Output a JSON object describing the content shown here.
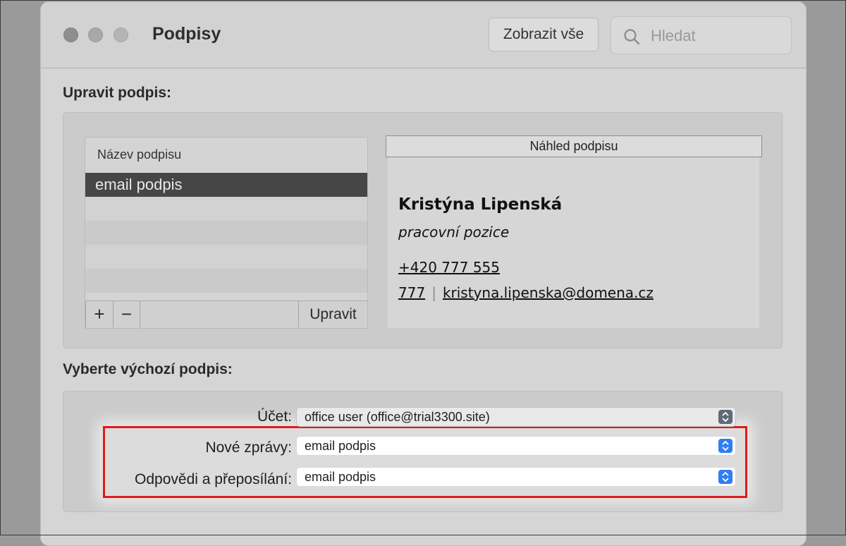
{
  "window": {
    "title": "Podpisy"
  },
  "toolbar": {
    "show_all_label": "Zobrazit vše",
    "search_placeholder": "Hledat"
  },
  "edit_section": {
    "title": "Upravit podpis:",
    "list_header": "Název podpisu",
    "signatures": [
      "email podpis"
    ],
    "selected_index": 0,
    "add_label": "+",
    "remove_label": "−",
    "edit_button_label": "Upravit"
  },
  "preview": {
    "header": "Náhled podpisu",
    "name": "Kristýna Lipenská",
    "position": "pracovní pozice",
    "phone": "+420 777 555",
    "extension": "777",
    "separator": "|",
    "email": "kristyna.lipenska@domena.cz"
  },
  "default_section": {
    "title": "Vyberte výchozí podpis:",
    "account_label": "Účet:",
    "account_value": "office user (office@trial3300.site)",
    "new_messages_label": "Nové zprávy:",
    "new_messages_value": "email podpis",
    "replies_label": "Odpovědi a přeposílání:",
    "replies_value": "email podpis"
  },
  "colors": {
    "highlight_border": "#e01b1b",
    "stepper_active": "#2f7ef3"
  },
  "icons": {
    "search": "search-icon",
    "stepper": "chevron-updown-icon"
  }
}
